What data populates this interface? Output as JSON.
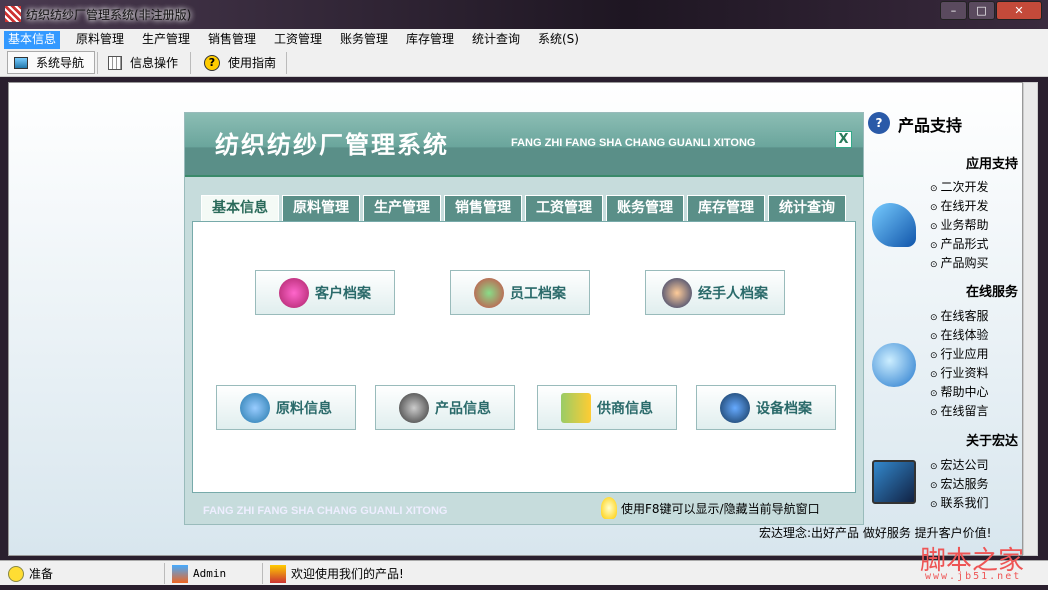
{
  "window": {
    "title": "纺织纺纱厂管理系统(非注册版)",
    "min": "–",
    "max": "□",
    "close": "✕"
  },
  "menu": [
    "基本信息",
    "原料管理",
    "生产管理",
    "销售管理",
    "工资管理",
    "账务管理",
    "库存管理",
    "统计查询",
    "系统(S)"
  ],
  "toolbar": [
    "系统导航",
    "信息操作",
    "使用指南"
  ],
  "panel": {
    "title": "纺织纺纱厂管理系统",
    "subtitle": "FANG ZHI FANG SHA CHANG GUANLI XITONG",
    "close": "X",
    "tabs": [
      "基本信息",
      "原料管理",
      "生产管理",
      "销售管理",
      "工资管理",
      "账务管理",
      "库存管理",
      "统计查询"
    ],
    "buttons_row1": [
      "客户档案",
      "员工档案",
      "经手人档案"
    ],
    "buttons_row2": [
      "原料信息",
      "产品信息",
      "供商信息",
      "设备档案"
    ],
    "footer_en": "FANG ZHI FANG SHA CHANG GUANLI XITONG",
    "tip": "使用F8键可以显示/隐藏当前导航窗口"
  },
  "support": {
    "title": "产品支持",
    "sections": [
      {
        "heading": "应用支持",
        "items": [
          "二次开发",
          "在线开发",
          "业务帮助",
          "产品形式",
          "产品购买"
        ]
      },
      {
        "heading": "在线服务",
        "items": [
          "在线客服",
          "在线体验",
          "行业应用",
          "行业资料",
          "帮助中心",
          "在线留言"
        ]
      },
      {
        "heading": "关于宏达",
        "items": [
          "宏达公司",
          "宏达服务",
          "联系我们"
        ]
      }
    ],
    "motto": "宏达理念:出好产品 做好服务 提升客户价值!"
  },
  "status": [
    "准备",
    "Admin",
    "欢迎使用我们的产品!"
  ],
  "watermark": {
    "cn": "脚本之家",
    "url": "www.jb51.net"
  }
}
